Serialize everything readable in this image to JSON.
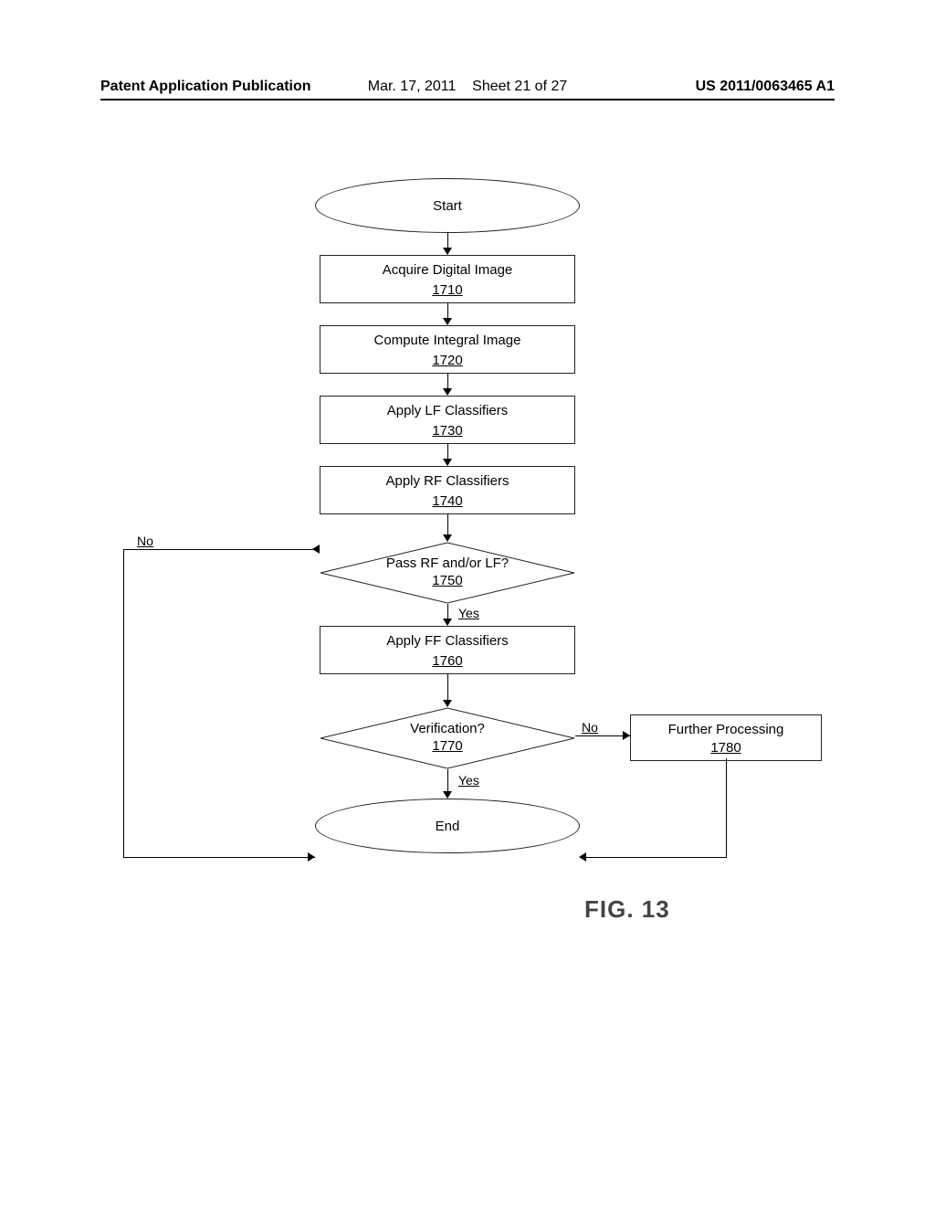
{
  "header": {
    "left": "Patent Application Publication",
    "date": "Mar. 17, 2011",
    "sheet": "Sheet 21 of 27",
    "pubnum": "US 2011/0063465 A1"
  },
  "flow": {
    "start": "Start",
    "steps": [
      {
        "label": "Acquire Digital Image",
        "ref": "1710"
      },
      {
        "label": "Compute Integral Image",
        "ref": "1720"
      },
      {
        "label": "Apply LF Classifiers",
        "ref": "1730"
      },
      {
        "label": "Apply RF Classifiers",
        "ref": "1740"
      }
    ],
    "decision1": {
      "label": "Pass RF and/or LF?",
      "ref": "1750",
      "yes": "Yes",
      "no": "No"
    },
    "step_ff": {
      "label": "Apply FF Classifiers",
      "ref": "1760"
    },
    "decision2": {
      "label": "Verification?",
      "ref": "1770",
      "yes": "Yes",
      "no": "No"
    },
    "further": {
      "label": "Further Processing",
      "ref": "1780"
    },
    "end": "End"
  },
  "figure": "FIG. 13"
}
